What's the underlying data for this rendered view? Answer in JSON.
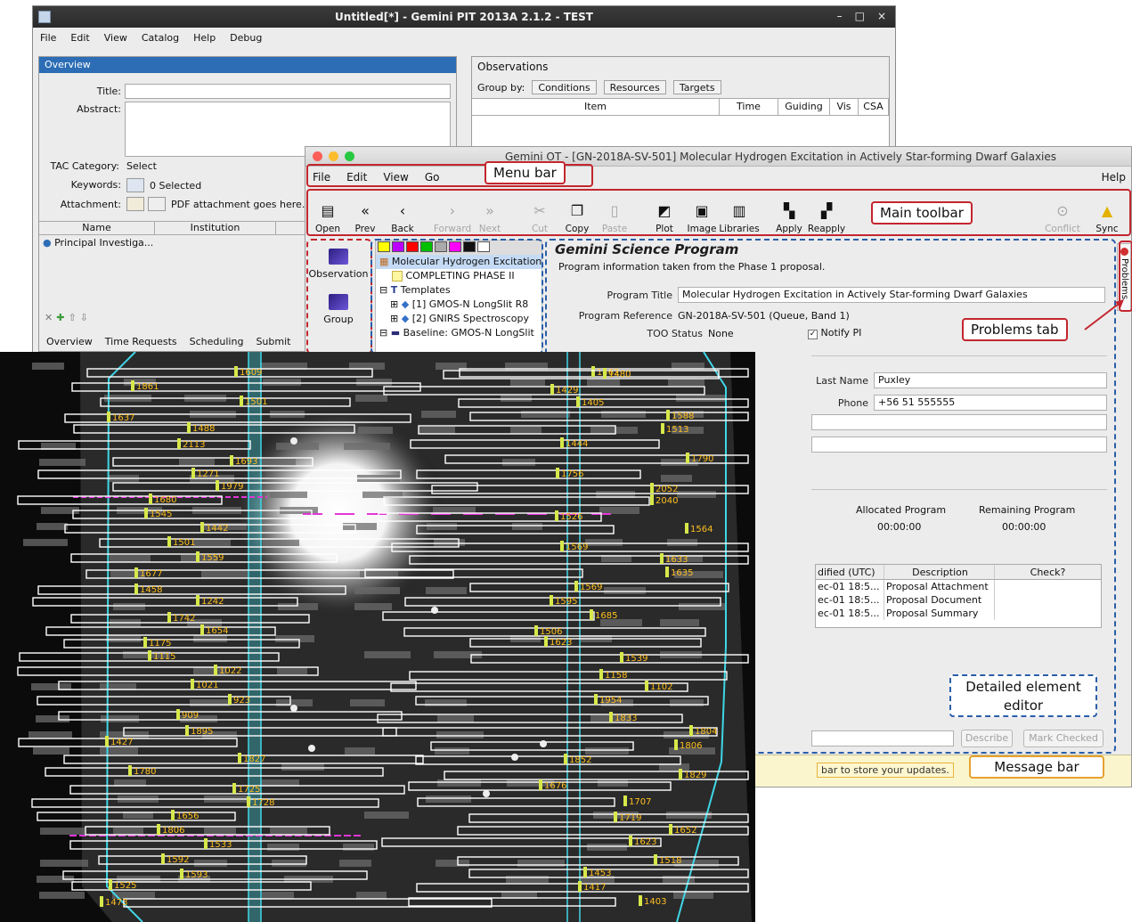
{
  "pit": {
    "title": "Untitled[*] - Gemini PIT 2013A 2.1.2 - TEST",
    "window_controls": [
      "–",
      "□",
      "×"
    ],
    "menu": [
      "File",
      "Edit",
      "View",
      "Catalog",
      "Help",
      "Debug"
    ],
    "overview": {
      "header": "Overview",
      "title_label": "Title:",
      "abstract_label": "Abstract:",
      "tac_label": "TAC Category:",
      "tac_value": "Select",
      "keywords_label": "Keywords:",
      "keywords_value": "0 Selected",
      "attachment_label": "Attachment:",
      "attachment_value": "PDF attachment goes here.",
      "columns": [
        "Name",
        "Institution"
      ],
      "pi_row": "Principal Investiga...",
      "tabs": [
        "Overview",
        "Time Requests",
        "Scheduling",
        "Submit"
      ]
    },
    "observations": {
      "title": "Observations",
      "group_by": "Group by:",
      "buttons": [
        "Conditions",
        "Resources",
        "Targets"
      ],
      "columns": [
        "Item",
        "Time",
        "Guiding",
        "Vis",
        "CSA"
      ]
    }
  },
  "ot": {
    "title": "Gemini OT - [GN-2018A-SV-501] Molecular Hydrogen Excitation in Actively Star-forming Dwarf Galaxies",
    "menu": [
      "File",
      "Edit",
      "View",
      "Go"
    ],
    "menu_help": "Help",
    "toolbar": [
      {
        "label": "Open",
        "icon": "open-icon",
        "glyph": "▤",
        "enabled": true
      },
      {
        "label": "Prev",
        "icon": "prev-icon",
        "glyph": "«",
        "enabled": true
      },
      {
        "label": "Back",
        "icon": "back-icon",
        "glyph": "‹",
        "enabled": true
      },
      {
        "label": "Forward",
        "icon": "forward-icon",
        "glyph": "›",
        "enabled": false
      },
      {
        "label": "Next",
        "icon": "next-icon",
        "glyph": "»",
        "enabled": false
      },
      {
        "label": "Cut",
        "icon": "cut-icon",
        "glyph": "✂",
        "enabled": false
      },
      {
        "label": "Copy",
        "icon": "copy-icon",
        "glyph": "❐",
        "enabled": true
      },
      {
        "label": "Paste",
        "icon": "paste-icon",
        "glyph": "▯",
        "enabled": false
      },
      {
        "label": "Plot",
        "icon": "plot-icon",
        "glyph": "◩",
        "enabled": true
      },
      {
        "label": "Image",
        "icon": "image-icon",
        "glyph": "▣",
        "enabled": true
      },
      {
        "label": "Libraries",
        "icon": "libraries-icon",
        "glyph": "▥",
        "enabled": true
      },
      {
        "label": "Apply",
        "icon": "apply-icon",
        "glyph": "▚",
        "enabled": true
      },
      {
        "label": "Reapply",
        "icon": "reapply-icon",
        "glyph": "▞",
        "enabled": true
      }
    ],
    "toolbar_right": [
      {
        "label": "Conflict",
        "icon": "conflict-icon",
        "glyph": "⊙",
        "enabled": false
      },
      {
        "label": "Sync",
        "icon": "sync-icon",
        "glyph": "▲",
        "enabled": true
      }
    ],
    "palette": [
      "Observation",
      "Group"
    ],
    "tree": [
      "Molecular Hydrogen Excitation",
      "COMPLETING PHASE II",
      "Templates",
      "[1] GMOS-N LongSlit R8",
      "[2] GNIRS Spectroscopy",
      "Baseline: GMOS-N LongSlit"
    ],
    "editor": {
      "title": "Gemini Science Program",
      "subtitle": "Program information taken from the Phase 1 proposal.",
      "program_title_label": "Program Title",
      "program_title": "Molecular Hydrogen Excitation in Actively Star-forming Dwarf Galaxies",
      "program_ref_label": "Program Reference",
      "program_ref": "GN-2018A-SV-501 (Queue, Band 1)",
      "too_label": "TOO Status",
      "too_value": "None",
      "notify_pi": "Notify PI",
      "last_name_label": "Last Name",
      "last_name": "Puxley",
      "phone_label": "Phone",
      "phone": "+56 51 555555",
      "allocated_label": "Allocated Program",
      "allocated_value": "00:00:00",
      "remaining_label": "Remaining Program",
      "remaining_value": "00:00:00",
      "att_columns": [
        "dified (UTC)",
        "Description",
        "Check?"
      ],
      "att_rows": [
        {
          "modified": "ec-01 18:5...",
          "description": "Proposal Attachment"
        },
        {
          "modified": "ec-01 18:5...",
          "description": "Proposal Document"
        },
        {
          "modified": "ec-01 18:5...",
          "description": "Proposal Summary"
        }
      ],
      "describe_button": "Describe",
      "mark_checked_button": "Mark Checked"
    },
    "problems_tab": "Problems",
    "message": "bar to store your updates."
  },
  "annotations": {
    "menu_bar": "Menu bar",
    "main_toolbar": "Main toolbar",
    "problems_tab": "Problems tab",
    "detailed_editor": "Detailed element editor",
    "message_bar": "Message bar"
  },
  "sky": {
    "slit_labels": [
      "1609",
      "1861",
      "1501",
      "1637",
      "1488",
      "2113",
      "1693",
      "1271",
      "1979",
      "1680",
      "1545",
      "1442",
      "1501",
      "1559",
      "1677",
      "1458",
      "1242",
      "1742",
      "1654",
      "1175",
      "1115",
      "1022",
      "1021",
      "923",
      "909",
      "1895",
      "1427",
      "1827",
      "1780",
      "1725",
      "1728",
      "1656",
      "1806",
      "1533",
      "1592",
      "1593",
      "1525",
      "1473",
      "1462",
      "1429",
      "1405",
      "1588",
      "1513",
      "1444",
      "1790",
      "1756",
      "2052",
      "2040",
      "1526",
      "1564",
      "1569",
      "1633",
      "1635",
      "1569",
      "1595",
      "1685",
      "1506",
      "1623",
      "1539",
      "1158",
      "1102",
      "1954",
      "1833",
      "1804",
      "1806",
      "1852",
      "1829",
      "1676",
      "1707",
      "1719",
      "1652",
      "1623",
      "1518",
      "1453",
      "1417",
      "1403",
      "1480"
    ],
    "colors": {
      "slit": "#ffffff",
      "label": "#ffc020",
      "marker": "#d7e84a",
      "cyan": "#3fd6e6",
      "magenta": "#e236d8"
    }
  }
}
